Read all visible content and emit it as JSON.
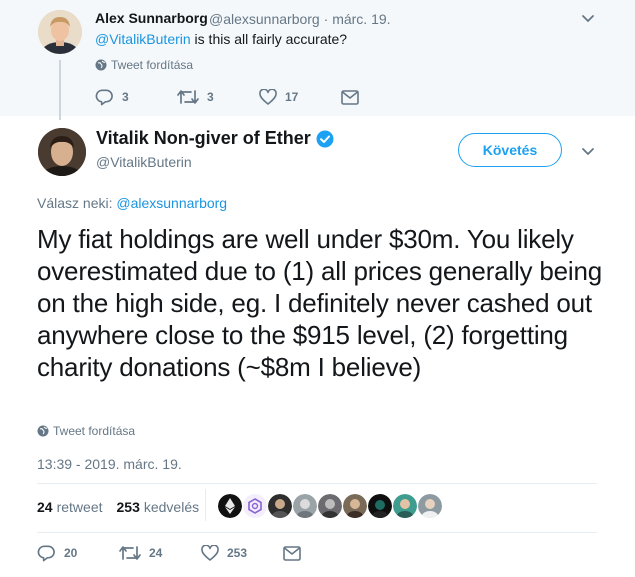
{
  "parent_tweet": {
    "author_name": "Alex Sunnarborg",
    "author_handle": "@alexsunnarborg",
    "separator": "·",
    "date": "márc. 19.",
    "mention": "@VitalikButerin",
    "text": " is this all fairly accurate?",
    "translate_label": "Tweet fordítása",
    "replies": "3",
    "retweets": "3",
    "likes": "17"
  },
  "main_tweet": {
    "author_name": "Vitalik Non-giver of Ether",
    "author_handle": "@VitalikButerin",
    "follow_label": "Követés",
    "reply_prefix": "Válasz neki: ",
    "reply_mention": "@alexsunnarborg",
    "text": "My fiat holdings are well under $30m. You likely overestimated due to (1) all prices generally being on the high side, eg. I definitely never cashed out anywhere close to the $915 level, (2) forgetting charity donations (~$8m I believe)",
    "translate_label": "Tweet fordítása",
    "timestamp": "13:39 - 2019. márc. 19.",
    "retweet_count": "24",
    "retweet_label": "retweet",
    "like_count": "253",
    "like_label": "kedvelés",
    "liker_icons": [
      "ethereum-icon",
      "polygon-icon",
      "person-icon",
      "person-icon",
      "person-icon",
      "person-icon",
      "person-icon",
      "person-icon",
      "person-icon"
    ],
    "replies": "20",
    "retweets": "24",
    "likes": "253"
  },
  "colors": {
    "accent": "#1da1f2",
    "link": "#1b95e0",
    "verified": "#1da1f2",
    "muted": "#657786",
    "parent_bg": "#f5f8fa"
  }
}
